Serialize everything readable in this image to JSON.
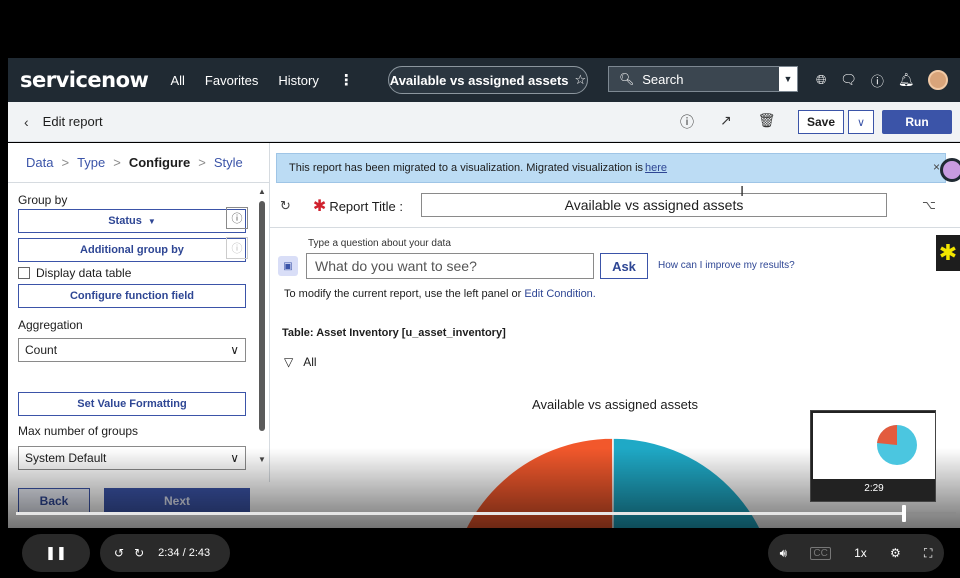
{
  "header": {
    "logo": "servicenow",
    "nav": [
      "All",
      "Favorites",
      "History",
      "⋮"
    ],
    "pill_title": "Available vs assigned assets",
    "pill_star": "☆",
    "search_placeholder": "Search"
  },
  "toolbar": {
    "title": "Edit report",
    "save_label": "Save",
    "run_label": "Run"
  },
  "steps": {
    "data": "Data",
    "type": "Type",
    "configure": "Configure",
    "style": "Style"
  },
  "left": {
    "group_by_label": "Group by",
    "group_by_value": "Status",
    "additional_group_by": "Additional group by",
    "display_data_table": "Display data table",
    "configure_function_field": "Configure function field",
    "aggregation_label": "Aggregation",
    "aggregation_value": "Count",
    "set_value_formatting": "Set Value Formatting",
    "max_groups_label": "Max number of groups",
    "max_groups_value": "System Default",
    "back_label": "Back",
    "next_label": "Next"
  },
  "main": {
    "banner_text": "This report has been migrated to a visualization. Migrated visualization is",
    "banner_link": "here",
    "report_title_label": "Report Title :",
    "report_title_value": "Available vs assigned assets",
    "qa_hint": "Type a question about your data",
    "qa_placeholder": "What do you want to see?",
    "ask_label": "Ask",
    "improve_link": "How can I improve my results?",
    "modify_text": "To modify the current report, use the left panel or",
    "edit_condition": "Edit Condition.",
    "table_info": "Table: Asset Inventory [u_asset_inventory]",
    "filter_value": "All",
    "chart_title": "Available vs assigned assets"
  },
  "chart_data": {
    "type": "pie",
    "title": "Available vs assigned assets",
    "slice_colors": [
      "#f2582c",
      "#1fa9c6"
    ]
  },
  "video": {
    "current_time": "2:34",
    "total_time": "2:43",
    "time_display": "2:34 / 2:43",
    "speed": "1x",
    "progress": 0.945,
    "preview_time": "2:29"
  },
  "colors": {
    "header_bg": "#202a33",
    "accent": "#3b54a8",
    "banner_bg": "#bcdcf4"
  }
}
